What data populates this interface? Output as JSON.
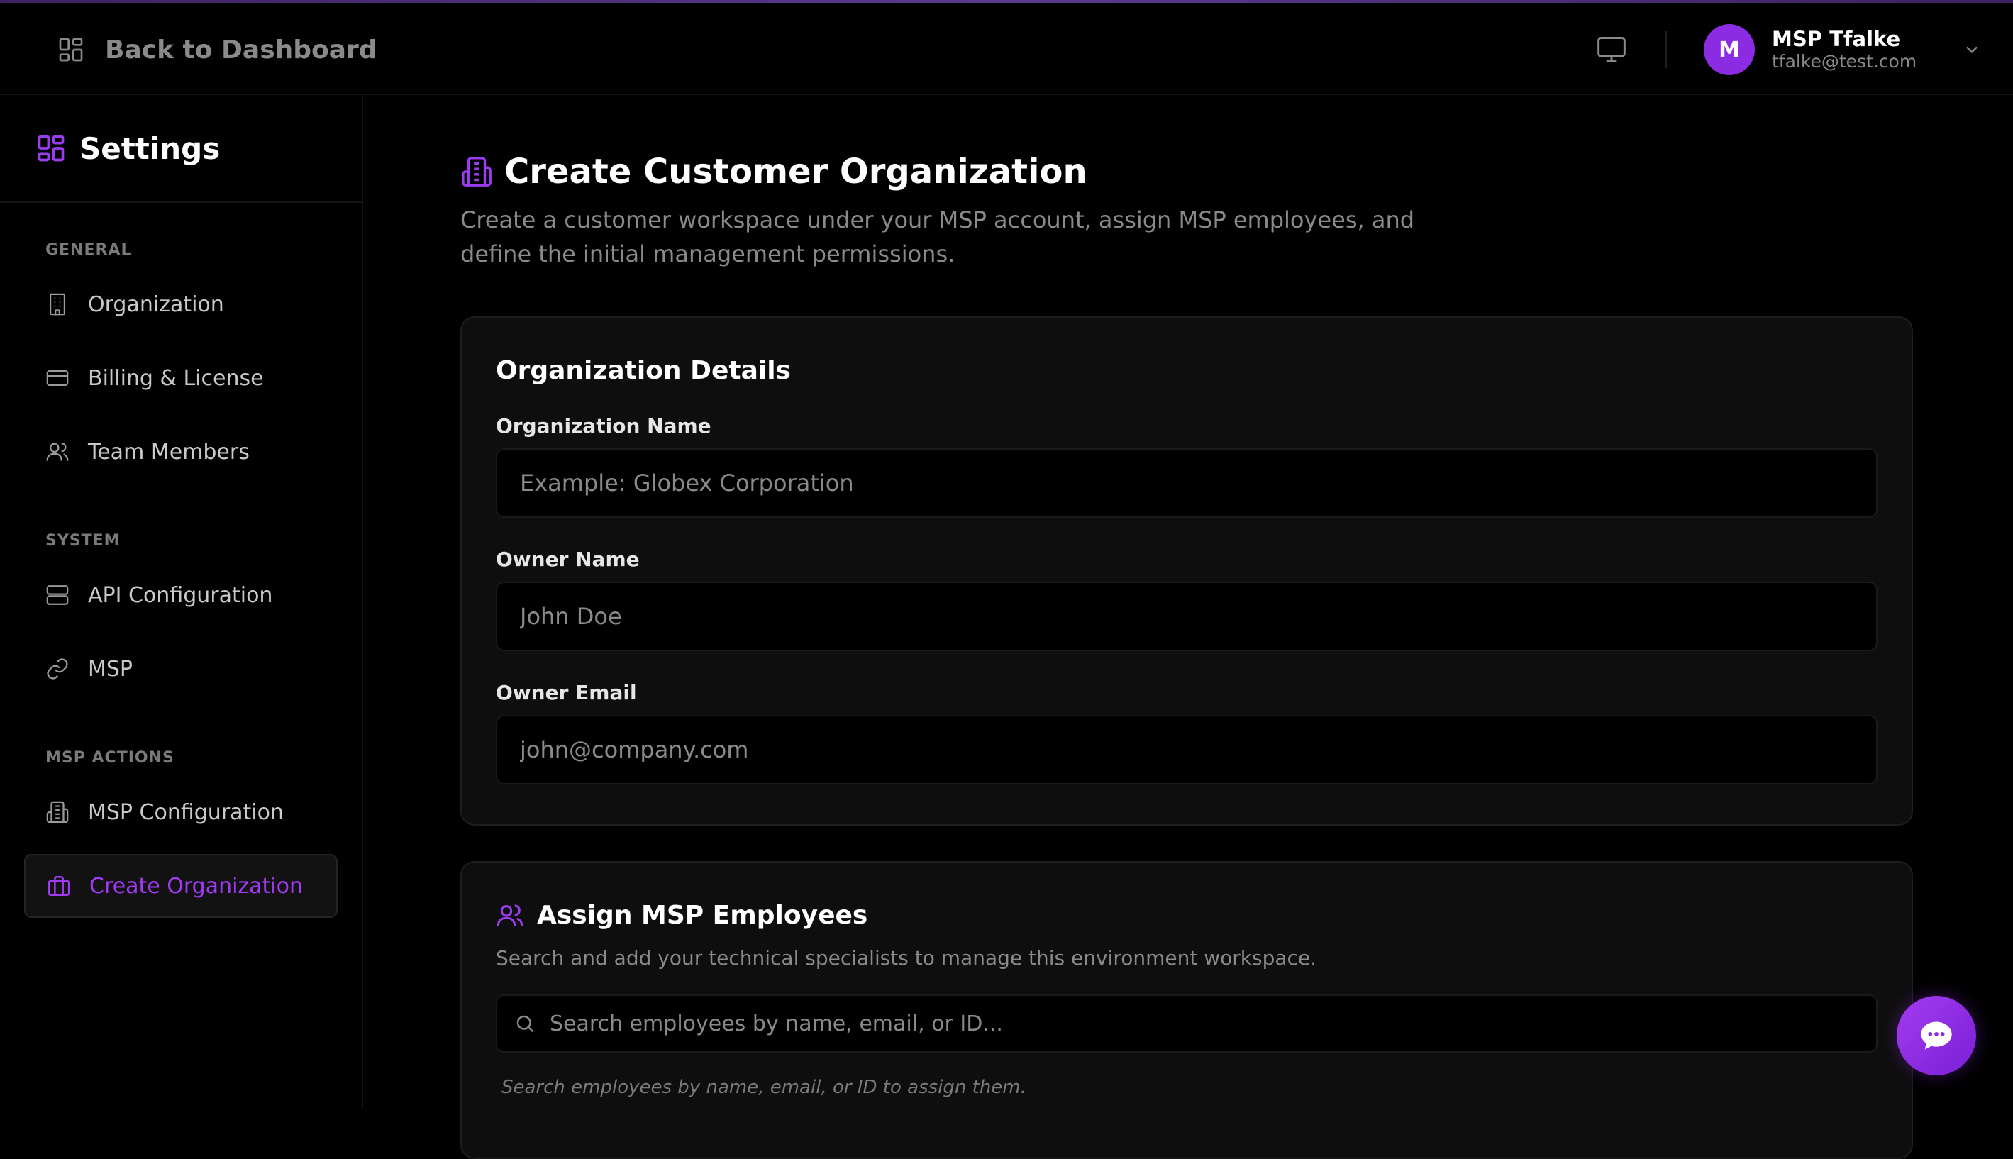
{
  "header": {
    "back_label": "Back to Dashboard",
    "user": {
      "initial": "M",
      "name": "MSP Tfalke",
      "email": "tfalke@test.com"
    }
  },
  "sidebar": {
    "title": "Settings",
    "sections": [
      {
        "label": "GENERAL"
      },
      {
        "label": "SYSTEM"
      },
      {
        "label": "MSP ACTIONS"
      }
    ],
    "items": [
      {
        "label": "Organization",
        "icon": "building-icon"
      },
      {
        "label": "Billing & License",
        "icon": "credit-card-icon"
      },
      {
        "label": "Team Members",
        "icon": "users-icon"
      },
      {
        "label": "API Configuration",
        "icon": "server-icon"
      },
      {
        "label": "MSP",
        "icon": "link-icon"
      },
      {
        "label": "MSP Configuration",
        "icon": "building-2-icon"
      },
      {
        "label": "Create Organization",
        "icon": "briefcase-icon",
        "active": true
      }
    ]
  },
  "main": {
    "title": "Create Customer Organization",
    "description": "Create a customer workspace under your MSP account, assign MSP employees, and define the initial management permissions.",
    "org_details": {
      "title": "Organization Details",
      "fields": [
        {
          "label": "Organization Name",
          "placeholder": "Example: Globex Corporation",
          "value": ""
        },
        {
          "label": "Owner Name",
          "placeholder": "John Doe",
          "value": ""
        },
        {
          "label": "Owner Email",
          "placeholder": "john@company.com",
          "value": ""
        }
      ]
    },
    "employees": {
      "title": "Assign MSP Employees",
      "description": "Search and add your technical specialists to manage this environment workspace.",
      "search_placeholder": "Search employees by name, email, or ID...",
      "hint": "Search employees by name, email, or ID to assign them."
    }
  },
  "colors": {
    "accent": "#9b3cf0",
    "background": "#000000",
    "card": "#0e0e0e"
  }
}
